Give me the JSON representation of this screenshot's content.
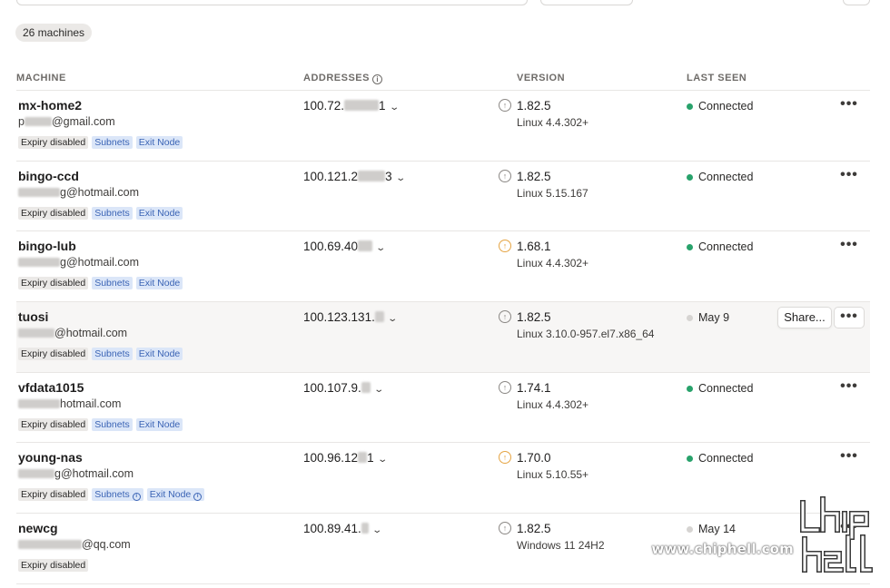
{
  "machine_count": "26 machines",
  "headers": {
    "machine": "MACHINE",
    "addresses": "ADDRESSES",
    "version": "VERSION",
    "last_seen": "LAST SEEN"
  },
  "row_actions": {
    "share_label": "Share...",
    "more_label": "•••"
  },
  "rows": [
    {
      "name": "mx-home2",
      "owner_prefix": "p",
      "owner_suffix": "@gmail.com",
      "tags": [
        "Expiry disabled",
        "Subnets",
        "Exit Node"
      ],
      "address": "100.72.",
      "address_tail": "1",
      "version": "1.82.5",
      "update_available": false,
      "os": "Linux 4.4.302+",
      "last_seen": "Connected",
      "online": true
    },
    {
      "name": "bingo-ccd",
      "owner_prefix": "",
      "owner_suffix": "g@hotmail.com",
      "tags": [
        "Expiry disabled",
        "Subnets",
        "Exit Node"
      ],
      "address": "100.121.2",
      "address_tail": "3",
      "version": "1.82.5",
      "update_available": false,
      "os": "Linux 5.15.167",
      "last_seen": "Connected",
      "online": true
    },
    {
      "name": "bingo-lub",
      "owner_prefix": "",
      "owner_suffix": "g@hotmail.com",
      "tags": [
        "Expiry disabled",
        "Subnets",
        "Exit Node"
      ],
      "address": "100.69.40",
      "address_tail": "",
      "version": "1.68.1",
      "update_available": true,
      "os": "Linux 4.4.302+",
      "last_seen": "Connected",
      "online": true
    },
    {
      "name": "tuosi",
      "owner_prefix": "",
      "owner_suffix": "@hotmail.com",
      "tags": [
        "Expiry disabled",
        "Subnets",
        "Exit Node"
      ],
      "address": "100.123.131.",
      "address_tail": "",
      "version": "1.82.5",
      "update_available": false,
      "os": "Linux 3.10.0-957.el7.x86_64",
      "last_seen": "May 9",
      "online": false
    },
    {
      "name": "vfdata1015",
      "owner_prefix": "",
      "owner_suffix": "hotmail.com",
      "tags": [
        "Expiry disabled",
        "Subnets",
        "Exit Node"
      ],
      "address": "100.107.9.",
      "address_tail": "",
      "version": "1.74.1",
      "update_available": false,
      "os": "Linux 4.4.302+",
      "last_seen": "Connected",
      "online": true
    },
    {
      "name": "young-nas",
      "owner_prefix": "",
      "owner_suffix": "g@hotmail.com",
      "tags": [
        "Expiry disabled",
        "Subnets",
        "Exit Node"
      ],
      "address": "100.96.12",
      "address_tail": "1",
      "version": "1.70.0",
      "update_available": true,
      "os": "Linux 5.10.55+",
      "last_seen": "Connected",
      "online": true
    },
    {
      "name": "newcg",
      "owner_prefix": "",
      "owner_suffix": "@qq.com",
      "tags": [
        "Expiry disabled"
      ],
      "address": "100.89.41.",
      "address_tail": "",
      "version": "1.82.5",
      "update_available": false,
      "os": "Windows 11 24H2",
      "last_seen": "May 14",
      "online": false
    }
  ],
  "watermark": {
    "text": "www.chiphell.com",
    "logo_text": "chip hell"
  },
  "colors": {
    "connected": "#28a26b",
    "offline": "#d6d4d2",
    "update_warning": "#e5a443",
    "tag_blue_bg": "#dbe6f8",
    "tag_blue_fg": "#3b64b5"
  }
}
